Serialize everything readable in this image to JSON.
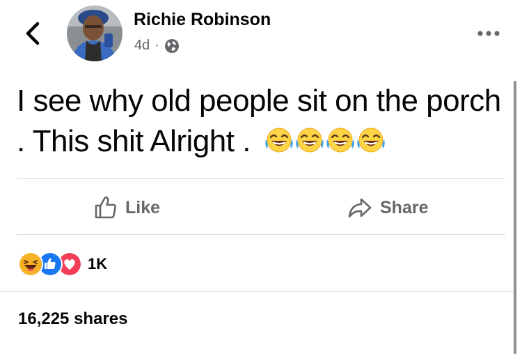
{
  "post": {
    "author": "Richie Robinson",
    "time": "4d",
    "separator": "·",
    "audience_icon": "globe-icon",
    "text": "I see why old people sit on the porch . This shit Alright .",
    "inline_emojis": [
      "face-with-tears-of-joy-emoji",
      "face-with-tears-of-joy-emoji",
      "face-with-tears-of-joy-emoji",
      "face-with-tears-of-joy-emoji"
    ]
  },
  "actions": {
    "like_label": "Like",
    "share_label": "Share"
  },
  "reactions": {
    "icons": [
      "haha-icon",
      "like-icon",
      "love-icon"
    ],
    "count": "1K"
  },
  "shares": {
    "label": "16,225 shares"
  },
  "colors": {
    "text": "#050505",
    "secondary": "#65676b",
    "divider": "#dadde1",
    "like_blue": "#1877f2",
    "love_red": "#f33e58",
    "haha_yellow": "#f7b125"
  }
}
